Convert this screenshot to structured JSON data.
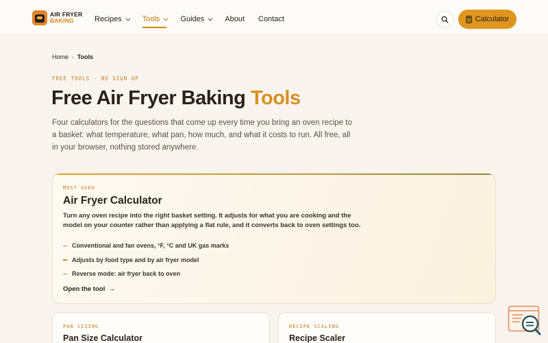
{
  "brand": {
    "line1": "AIR FRYER",
    "line2": "BAKING"
  },
  "nav": {
    "items": [
      {
        "label": "Recipes",
        "has_dropdown": true,
        "active": false
      },
      {
        "label": "Tools",
        "has_dropdown": true,
        "active": true
      },
      {
        "label": "Guides",
        "has_dropdown": true,
        "active": false
      },
      {
        "label": "About",
        "has_dropdown": false,
        "active": false
      },
      {
        "label": "Contact",
        "has_dropdown": false,
        "active": false
      }
    ],
    "search_icon": "search-icon",
    "cta_label": "Calculator",
    "cta_icon": "calculator-icon"
  },
  "breadcrumb": {
    "home": "Home",
    "current": "Tools"
  },
  "hero": {
    "eyebrow": "FREE TOOLS · NO SIGN UP",
    "title_main": "Free Air Fryer Baking ",
    "title_accent": "Tools",
    "intro": "Four calculators for the questions that come up every time you bring an oven recipe to a basket: what temperature, what pan, how much, and what it costs to run. All free, all in your browser, nothing stored anywhere."
  },
  "featured": {
    "eyebrow": "MOST USED",
    "title": "Air Fryer Calculator",
    "description": "Turn any oven recipe into the right basket setting. It adjusts for what you are cooking and the model on your counter rather than applying a flat rule, and it converts back to oven settings too.",
    "features": [
      "Conventional and fan ovens, °F, °C and UK gas marks",
      "Adjusts by food type and by air fryer model",
      "Reverse mode: air fryer back to oven"
    ],
    "link_label": "Open the tool",
    "link_arrow": "→"
  },
  "cards": [
    {
      "eyebrow": "PAN SIZING",
      "title": "Pan Size Calculator"
    },
    {
      "eyebrow": "RECIPE SCALING",
      "title": "Recipe Scaler"
    }
  ],
  "colors": {
    "accent": "#d98e1f",
    "background": "#f9f5ee",
    "text": "#2a211a",
    "cta": "#e0951f"
  }
}
